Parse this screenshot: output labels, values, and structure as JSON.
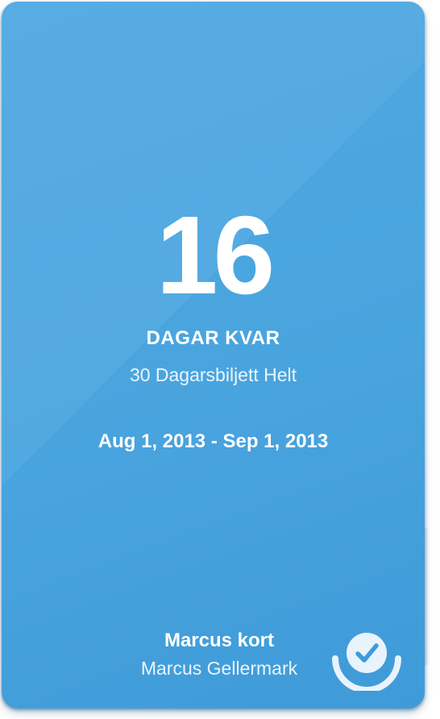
{
  "ticket": {
    "days_remaining": "16",
    "days_label": "DAGAR KVAR",
    "ticket_type": "30 Dagarsbiljett Helt",
    "date_range": "Aug 1, 2013 - Sep 1, 2013"
  },
  "card": {
    "name": "Marcus kort",
    "owner": "Marcus Gellermark"
  },
  "icons": {
    "validate": "check-circle-icon"
  },
  "colors": {
    "card_background": "#4aa5df",
    "text": "#ffffff",
    "icon_fill": "#e8f3fb",
    "check": "#3f9bd8"
  }
}
